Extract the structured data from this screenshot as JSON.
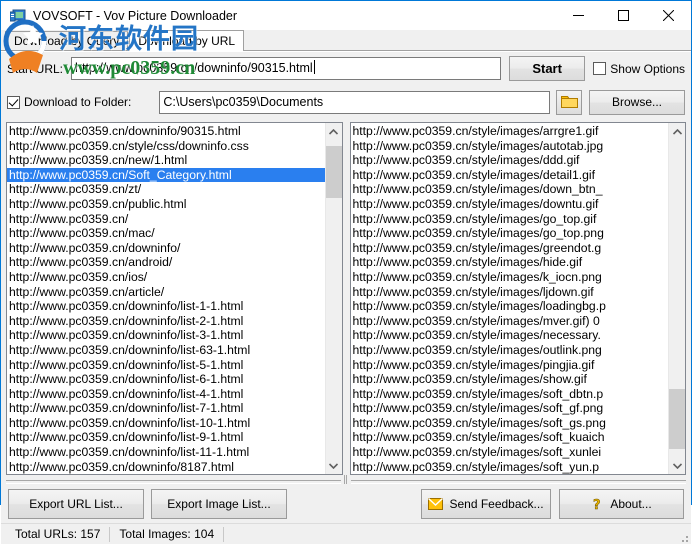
{
  "window": {
    "title": "VOVSOFT - Vov Picture Downloader",
    "icon": "app-icon",
    "controls": {
      "minimize": "—",
      "maximize": "☐",
      "close": "✕"
    }
  },
  "tabs": [
    {
      "label": "Download by Query",
      "active": false
    },
    {
      "label": "Download by URL",
      "active": true
    }
  ],
  "form": {
    "start_url_label": "Start URL:",
    "start_url_value": "http://www.pc0359.cn/downinfo/90315.html",
    "start_button": "Start",
    "show_options_label": "Show Options",
    "show_options_checked": false,
    "download_to_folder_label": "Download to Folder:",
    "download_to_folder_checked": true,
    "folder_value": "C:\\Users\\pc0359\\Documents",
    "open_folder_icon": "folder-icon",
    "browse_button": "Browse..."
  },
  "url_list": {
    "selected_index": 3,
    "items": [
      "http://www.pc0359.cn/downinfo/90315.html",
      "http://www.pc0359.cn/style/css/downinfo.css",
      "http://www.pc0359.cn/new/1.html",
      "http://www.pc0359.cn/Soft_Category.html",
      "http://www.pc0359.cn/zt/",
      "http://www.pc0359.cn/public.html",
      "http://www.pc0359.cn/",
      "http://www.pc0359.cn/mac/",
      "http://www.pc0359.cn/downinfo/",
      "http://www.pc0359.cn/android/",
      "http://www.pc0359.cn/ios/",
      "http://www.pc0359.cn/article/",
      "http://www.pc0359.cn/downinfo/list-1-1.html",
      "http://www.pc0359.cn/downinfo/list-2-1.html",
      "http://www.pc0359.cn/downinfo/list-3-1.html",
      "http://www.pc0359.cn/downinfo/list-63-1.html",
      "http://www.pc0359.cn/downinfo/list-5-1.html",
      "http://www.pc0359.cn/downinfo/list-6-1.html",
      "http://www.pc0359.cn/downinfo/list-4-1.html",
      "http://www.pc0359.cn/downinfo/list-7-1.html",
      "http://www.pc0359.cn/downinfo/list-10-1.html",
      "http://www.pc0359.cn/downinfo/list-9-1.html",
      "http://www.pc0359.cn/downinfo/list-11-1.html",
      "http://www.pc0359.cn/downinfo/8187.html"
    ]
  },
  "image_list": {
    "items": [
      "http://www.pc0359.cn/style/images/arrgre1.gif",
      "http://www.pc0359.cn/style/images/autotab.jpg",
      "http://www.pc0359.cn/style/images/ddd.gif",
      "http://www.pc0359.cn/style/images/detail1.gif",
      "http://www.pc0359.cn/style/images/down_btn_",
      "http://www.pc0359.cn/style/images/downtu.gif",
      "http://www.pc0359.cn/style/images/go_top.gif",
      "http://www.pc0359.cn/style/images/go_top.png",
      "http://www.pc0359.cn/style/images/greendot.g",
      "http://www.pc0359.cn/style/images/hide.gif",
      "http://www.pc0359.cn/style/images/k_iocn.png",
      "http://www.pc0359.cn/style/images/ljdown.gif",
      "http://www.pc0359.cn/style/images/loadingbg.p",
      "http://www.pc0359.cn/style/images/mver.gif) 0",
      "http://www.pc0359.cn/style/images/necessary.",
      "http://www.pc0359.cn/style/images/outlink.png",
      "http://www.pc0359.cn/style/images/pingjia.gif",
      "http://www.pc0359.cn/style/images/show.gif",
      "http://www.pc0359.cn/style/images/soft_dbtn.p",
      "http://www.pc0359.cn/style/images/soft_gf.png",
      "http://www.pc0359.cn/style/images/soft_gs.png",
      "http://www.pc0359.cn/style/images/soft_kuaich",
      "http://www.pc0359.cn/style/images/soft_xunlei",
      "http://www.pc0359.cn/style/images/soft_yun.p"
    ]
  },
  "bottom": {
    "export_url_list": "Export URL List...",
    "export_image_list": "Export Image List...",
    "send_feedback": "Send Feedback...",
    "send_feedback_icon": "envelope-icon",
    "about": "About...",
    "about_icon": "question-mark-icon"
  },
  "status": {
    "total_urls": "Total URLs: 157",
    "total_images": "Total Images: 104"
  },
  "watermark": {
    "chinese": "河东软件园",
    "site": "www.pc0359.cn"
  },
  "colors": {
    "accent": "#0078d7",
    "selection": "#2a7fef",
    "watermark_blue": "#2475c6",
    "watermark_green": "#1f8a36",
    "folder_yellow": "#ffc10a"
  }
}
